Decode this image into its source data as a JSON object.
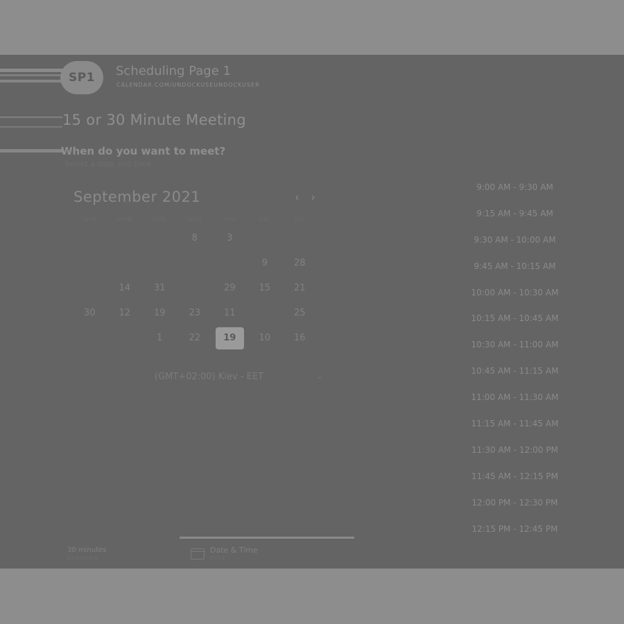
{
  "header": {
    "avatar_initials": "SP1",
    "title": "Scheduling Page 1",
    "url": "CALENDAR.COM/UNDOCKUSEUNDOCKUSER"
  },
  "meeting": {
    "title": "15 or 30 Minute Meeting",
    "question": "When do you want to meet?",
    "subtitle": "Select a date and time"
  },
  "calendar": {
    "month_label": "September 2021",
    "prev_icon": "chevron-left-icon",
    "next_icon": "chevron-right-icon",
    "weekdays": [
      "SUN",
      "MON",
      "TUE",
      "WED",
      "THU",
      "FRI",
      "SAT"
    ],
    "weeks": [
      [
        "",
        "",
        "",
        "8",
        "3",
        "",
        ""
      ],
      [
        "",
        "",
        "",
        "",
        "",
        "9",
        "28"
      ],
      [
        "",
        "14",
        "31",
        "",
        "29",
        "15",
        "21"
      ],
      [
        "30",
        "12",
        "19",
        "23",
        "11",
        "",
        "25"
      ],
      [
        "",
        "",
        "1",
        "22",
        "19",
        "10",
        "16"
      ]
    ],
    "selected": {
      "week": 4,
      "day": 4
    }
  },
  "timezone": {
    "label": "(GMT+02:00) Kiev - EET",
    "icon": "chevron-down-icon"
  },
  "time_slots": [
    "9:00 AM - 9:30 AM",
    "9:15 AM - 9:45 AM",
    "9:30 AM - 10:00 AM",
    "9:45 AM - 10:15 AM",
    "10:00 AM - 10:30 AM",
    "10:15 AM - 10:45 AM",
    "10:30 AM - 11:00 AM",
    "10:45 AM - 11:15 AM",
    "11:00 AM - 11:30 AM",
    "11:15 AM - 11:45 AM",
    "11:30 AM - 12:00 PM",
    "11:45 AM - 12:15 PM",
    "12:00 PM - 12:30 PM",
    "12:15 PM - 12:45 PM"
  ],
  "footer": {
    "duration": "30 minutes",
    "duration_sub": "DURATION",
    "step_label": "Date & Time",
    "step_sub": "DATE",
    "step_icon": "calendar-icon"
  }
}
